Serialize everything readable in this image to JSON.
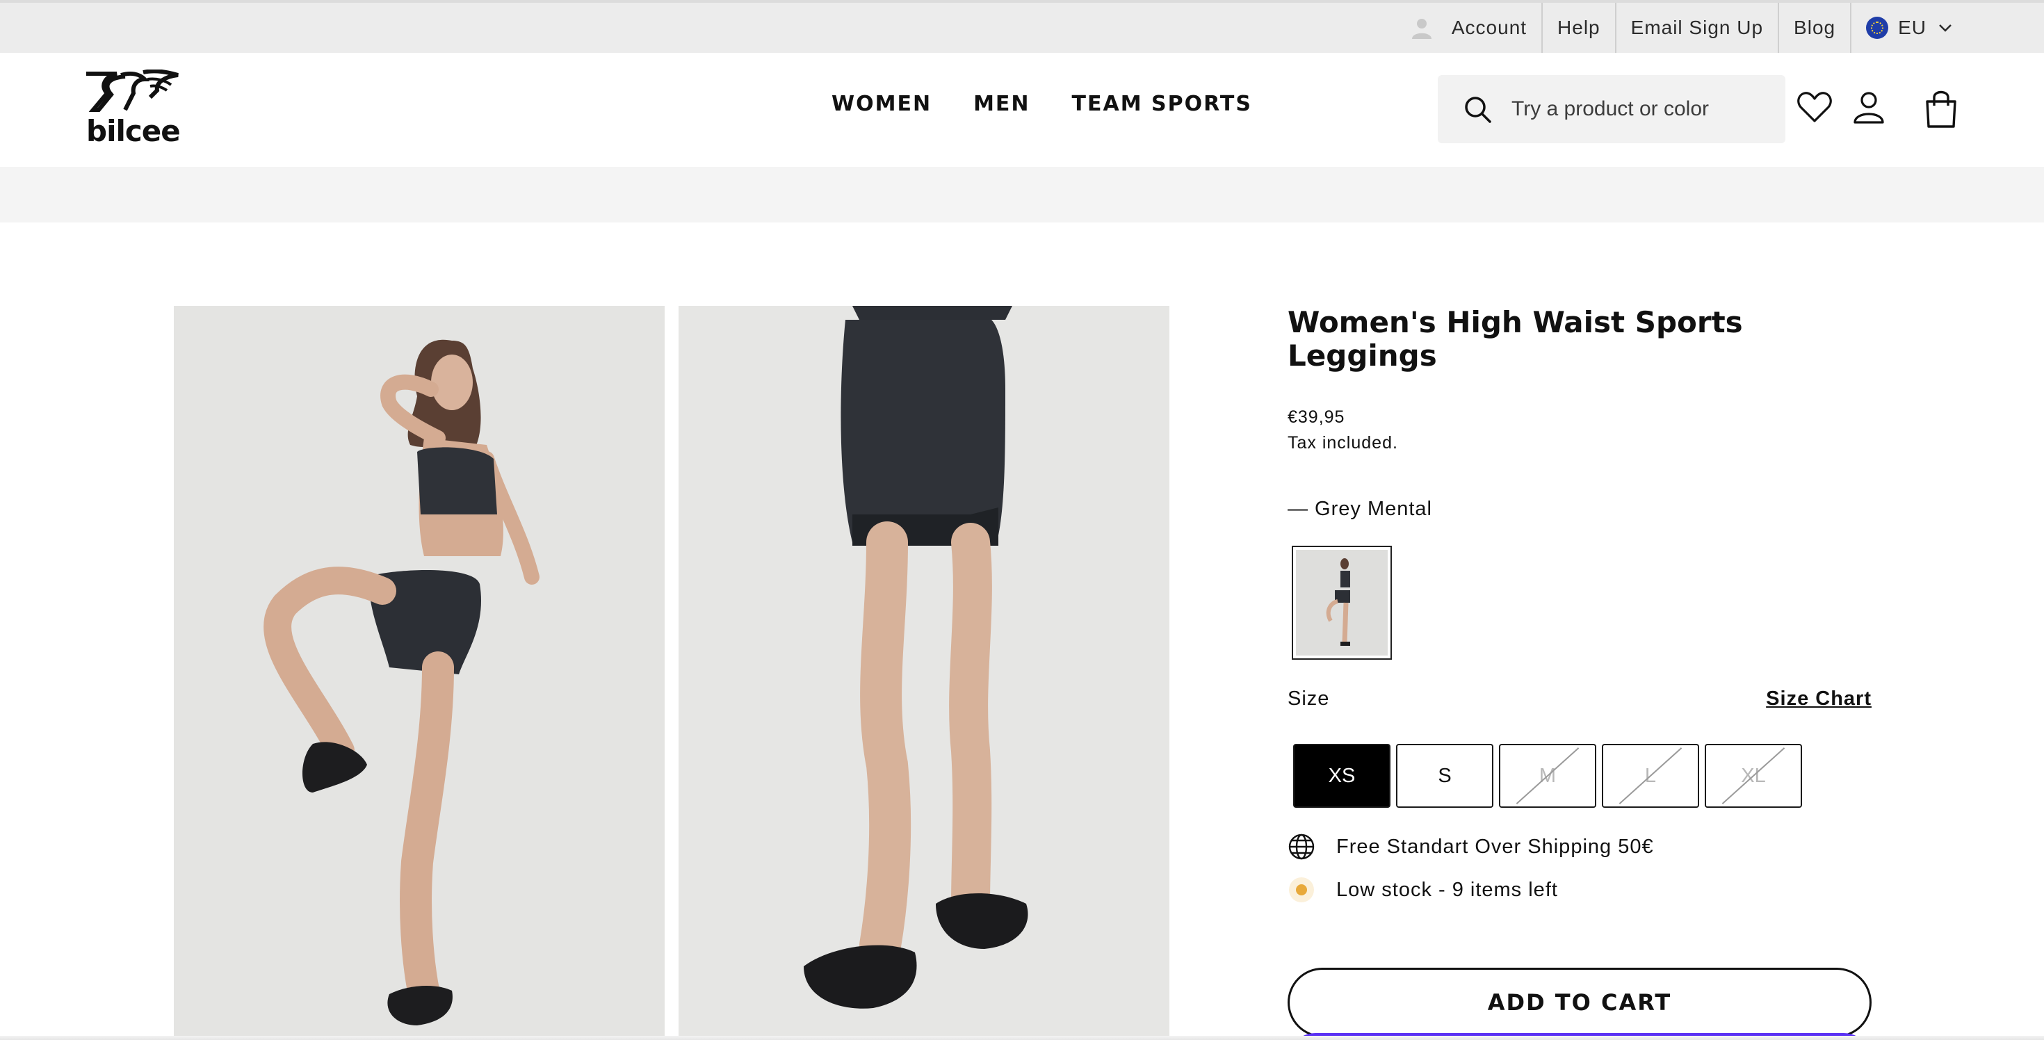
{
  "topbar": {
    "items": [
      {
        "label": "Account",
        "icon": "person-icon"
      },
      {
        "label": "Help"
      },
      {
        "label": "Email Sign Up"
      },
      {
        "label": "Blog"
      },
      {
        "label": "EU",
        "icon": "eu-flag-icon"
      }
    ]
  },
  "header": {
    "logo_text": "bilcee",
    "nav": [
      "WOMEN",
      "MEN",
      "TEAM SPORTS"
    ],
    "search_placeholder": "Try a product or color",
    "icons": [
      "wishlist-heart-icon",
      "account-icon",
      "cart-bag-icon"
    ]
  },
  "product": {
    "title": "Women's High Waist Sports Leggings",
    "price": "€39,95",
    "tax_note": "Tax included.",
    "color_label": "— Grey Mental",
    "size_label": "Size",
    "size_chart_link": "Size Chart",
    "sizes": [
      {
        "label": "XS",
        "state": "selected"
      },
      {
        "label": "S",
        "state": "available"
      },
      {
        "label": "M",
        "state": "sold-out"
      },
      {
        "label": "L",
        "state": "sold-out"
      },
      {
        "label": "XL",
        "state": "sold-out"
      }
    ],
    "shipping_note": "Free Standart Over Shipping 50€",
    "stock_note": "Low stock - 9 items left",
    "add_to_cart": "ADD TO CART"
  },
  "colors": {
    "topbar_bg": "#ececec",
    "band_bg": "#f4f4f4",
    "stock_dot": "#e8a93a",
    "shop_pay": "#5a31f4"
  }
}
